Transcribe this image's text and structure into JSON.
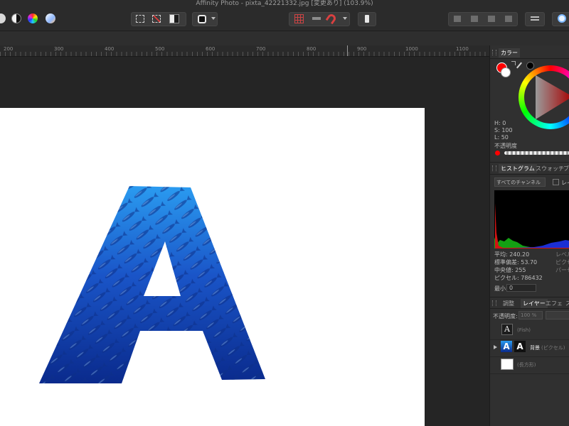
{
  "window": {
    "title": "Affinity Photo - pixta_42221332.jpg [変更あり] (103.9%)"
  },
  "ruler": {
    "labels": [
      "200",
      "300",
      "400",
      "500",
      "600",
      "700",
      "800",
      "900",
      "1000",
      "1100"
    ]
  },
  "panels": {
    "color": {
      "tab": "カラー",
      "h": "H: 0",
      "s": "S: 100",
      "l": "L: 50",
      "opacity_label": "不透明度",
      "primary": "#ff0000",
      "secondary": "#ffffff"
    },
    "histogram": {
      "tabs": [
        "ヒストグラム",
        "スウォッチ",
        "ブ"
      ],
      "channel_select": "すべてのチャンネル",
      "layer_checkbox": "レイ",
      "stats": [
        "平均: 240.20",
        "標準偏差: 53.70",
        "中央値: 255",
        "ピクセル: 786432"
      ],
      "right_stats": [
        "レベル",
        "ピクセ",
        "パーセ"
      ],
      "min_label": "最小:",
      "min_value": "0"
    },
    "layers": {
      "tabs": [
        "調整",
        "レイヤー",
        "エフェ",
        "ス"
      ],
      "opacity_label": "不透明度:",
      "opacity_value": "100 %",
      "items": [
        {
          "name": "(Fish)",
          "thumb": "A"
        },
        {
          "name": "背景",
          "kind": "(ピクセル)"
        },
        {
          "name": "(長方形)"
        }
      ]
    }
  },
  "canvas": {
    "letter": "A",
    "fill_color": "#1a55c8",
    "deep_color": "#0a2a8c"
  }
}
